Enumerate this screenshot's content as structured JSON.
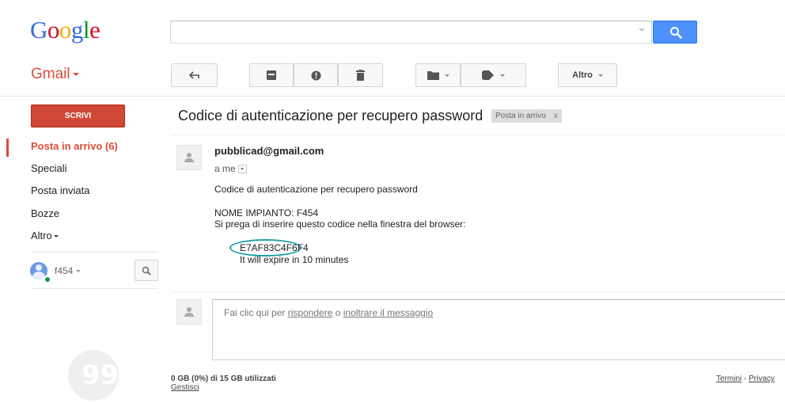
{
  "header": {
    "logo_letters": [
      {
        "ch": "G",
        "color": "#3369e8"
      },
      {
        "ch": "o",
        "color": "#d50f25"
      },
      {
        "ch": "o",
        "color": "#eeb211"
      },
      {
        "ch": "g",
        "color": "#3369e8"
      },
      {
        "ch": "l",
        "color": "#009925"
      },
      {
        "ch": "e",
        "color": "#d50f25"
      }
    ],
    "search_value": "",
    "search_icon": "search-icon"
  },
  "app_label": "Gmail",
  "toolbar": {
    "buttons": [
      "back-arrow-icon",
      "archive-icon",
      "report-spam-icon",
      "trash-icon",
      "move-to-folder-icon",
      "label-tag-icon"
    ],
    "more_label": "Altro"
  },
  "nav": {
    "compose_label": "SCRIVI",
    "items": [
      {
        "label": "Posta in arrivo (6)",
        "active": true
      },
      {
        "label": "Speciali"
      },
      {
        "label": "Posta inviata"
      },
      {
        "label": "Bozze"
      },
      {
        "label": "Altro"
      }
    ],
    "user_name": "f454",
    "hangouts_glyph": "99"
  },
  "message": {
    "subject": "Codice di autenticazione per recupero password",
    "label_chip": "Posta in arrivo",
    "label_close": "x",
    "sender": "pubblicad@gmail.com",
    "recipient": "a me",
    "body": [
      "Codice di autenticazione per recupero password",
      "NOME IMPIANTO: F454",
      "Si prega di inserire questo codice nella finestra del browser:"
    ],
    "code": "E7AF83C4F6F4",
    "expire": "It will expire in 10 minutes",
    "accent_color": "#1d9ea8"
  },
  "reply": {
    "prefix": "Fai clic qui per ",
    "reply_link": "rispondere",
    "middle": " o ",
    "forward_link": "inoltrare il messaggio"
  },
  "footer": {
    "storage": "0 GB (0%) di 15 GB utilizzati",
    "manage": "Gestisci",
    "terms": "Termini",
    "separator": " - ",
    "privacy": "Privacy"
  }
}
